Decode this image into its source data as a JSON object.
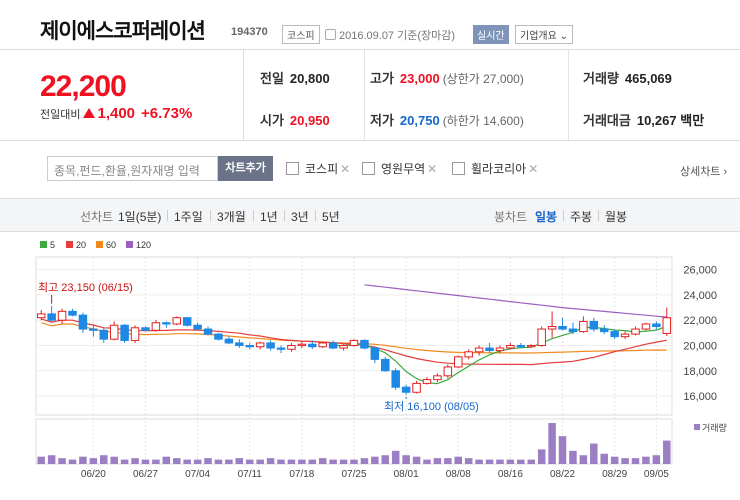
{
  "header": {
    "name": "제이에스코퍼레이션",
    "code": "194370",
    "market": "코스피",
    "date": "2016.09.07 기준(장마감)",
    "realtime": "실시간",
    "company_info": "기업개요"
  },
  "price": {
    "current": "22,200",
    "change_label": "전일대비",
    "change": "1,400",
    "change_pct": "+6.73%"
  },
  "stats": {
    "prev_label": "전일",
    "prev": "20,800",
    "high_label": "고가",
    "high": "23,000",
    "upper_limit": "(상한가 27,000)",
    "volume_label": "거래량",
    "volume": "465,069",
    "open_label": "시가",
    "open": "20,950",
    "low_label": "저가",
    "low": "20,750",
    "lower_limit": "(하한가 14,600)",
    "amount_label": "거래대금",
    "amount": "10,267",
    "amount_unit": "백만"
  },
  "compare": {
    "placeholder": "종목,펀드,환율,원자재명 입력",
    "add_button": "차트추가",
    "items": [
      "코스피",
      "영원무역",
      "휠라코리아"
    ],
    "detail": "상세차트"
  },
  "periods": {
    "line_label": "선차트",
    "line_options": [
      "1일(5분)",
      "1주일",
      "3개월",
      "1년",
      "3년",
      "5년"
    ],
    "candle_label": "봉차트",
    "candle_options": [
      "일봉",
      "주봉",
      "월봉"
    ],
    "active_candle": "일봉"
  },
  "colors": {
    "up": "#e12222",
    "down": "#1e88e5",
    "ma5": "#3daa3d",
    "ma20": "#e63c3c",
    "ma60": "#f08a1e",
    "ma120": "#9b5fc0",
    "volume": "#9b7ec4"
  },
  "legend": [
    "5",
    "20",
    "60",
    "120"
  ],
  "chart_data": {
    "type": "candlestick",
    "y_ticks": [
      "26,000",
      "24,000",
      "22,000",
      "20,000",
      "18,000",
      "16,000"
    ],
    "ylim": [
      14500,
      27000
    ],
    "x_labels": [
      "06/20",
      "06/27",
      "07/04",
      "07/11",
      "07/18",
      "07/25",
      "08/01",
      "08/08",
      "08/16",
      "08/22",
      "08/29",
      "09/05"
    ],
    "high_annotation": "최고 23,150 (06/15)",
    "low_annotation": "최저 16,100 (08/05)",
    "volume_label": "거래량",
    "candles": [
      [
        22200,
        22800,
        22000,
        22500
      ],
      [
        22500,
        23150,
        21800,
        22000
      ],
      [
        22000,
        22900,
        21700,
        22700
      ],
      [
        22700,
        22900,
        22300,
        22400
      ],
      [
        22400,
        22600,
        21000,
        21300
      ],
      [
        21300,
        21600,
        20700,
        21200
      ],
      [
        21200,
        21400,
        20200,
        20500
      ],
      [
        20500,
        21900,
        20400,
        21600
      ],
      [
        21600,
        21700,
        20200,
        20400
      ],
      [
        20400,
        21600,
        20200,
        21400
      ],
      [
        21400,
        21500,
        21100,
        21200
      ],
      [
        21200,
        22000,
        21100,
        21800
      ],
      [
        21800,
        21900,
        21400,
        21700
      ],
      [
        21700,
        22300,
        21600,
        22200
      ],
      [
        22200,
        22200,
        21500,
        21600
      ],
      [
        21600,
        21800,
        21200,
        21300
      ],
      [
        21300,
        21500,
        20800,
        20900
      ],
      [
        20900,
        21000,
        20400,
        20500
      ],
      [
        20500,
        20700,
        20100,
        20200
      ],
      [
        20200,
        20500,
        19800,
        20000
      ],
      [
        20000,
        20200,
        19700,
        19900
      ],
      [
        19900,
        20300,
        19700,
        20200
      ],
      [
        20200,
        20400,
        19600,
        19800
      ],
      [
        19800,
        20000,
        19400,
        19700
      ],
      [
        19700,
        20200,
        19500,
        20000
      ],
      [
        20000,
        20300,
        19800,
        20100
      ],
      [
        20100,
        20400,
        19700,
        19900
      ],
      [
        19900,
        20300,
        19800,
        20200
      ],
      [
        20200,
        20400,
        19700,
        19800
      ],
      [
        19800,
        20100,
        19600,
        20000
      ],
      [
        20000,
        20500,
        19900,
        20400
      ],
      [
        20400,
        20500,
        19700,
        19800
      ],
      [
        19800,
        19900,
        18600,
        18900
      ],
      [
        18900,
        19100,
        17900,
        18000
      ],
      [
        18000,
        18200,
        16500,
        16700
      ],
      [
        16700,
        16900,
        16100,
        16300
      ],
      [
        16300,
        17200,
        16200,
        17000
      ],
      [
        17000,
        17500,
        16900,
        17300
      ],
      [
        17300,
        17800,
        17100,
        17600
      ],
      [
        17600,
        18500,
        17400,
        18300
      ],
      [
        18300,
        19200,
        18200,
        19100
      ],
      [
        19100,
        19700,
        18900,
        19500
      ],
      [
        19500,
        20000,
        19200,
        19800
      ],
      [
        19800,
        20200,
        19400,
        19600
      ],
      [
        19600,
        20000,
        19400,
        19800
      ],
      [
        19800,
        20200,
        19700,
        20000
      ],
      [
        20000,
        20200,
        19800,
        19900
      ],
      [
        19900,
        20100,
        19800,
        20000
      ],
      [
        20000,
        21500,
        19900,
        21300
      ],
      [
        21300,
        22700,
        20600,
        21500
      ],
      [
        21500,
        22200,
        21200,
        21300
      ],
      [
        21300,
        21800,
        20900,
        21100
      ],
      [
        21100,
        22300,
        21000,
        21900
      ],
      [
        21900,
        22200,
        21100,
        21300
      ],
      [
        21300,
        21600,
        20900,
        21100
      ],
      [
        21100,
        21300,
        20500,
        20700
      ],
      [
        20700,
        21100,
        20500,
        20900
      ],
      [
        20900,
        21500,
        20800,
        21300
      ],
      [
        21300,
        21800,
        21200,
        21700
      ],
      [
        21700,
        21900,
        21300,
        21500
      ],
      [
        20950,
        23000,
        20750,
        22200
      ]
    ],
    "volumes": [
      5,
      6,
      4,
      3,
      5,
      4,
      6,
      5,
      3,
      4,
      3,
      3,
      5,
      4,
      3,
      3,
      4,
      3,
      3,
      4,
      3,
      3,
      4,
      3,
      3,
      3,
      3,
      4,
      3,
      3,
      3,
      4,
      5,
      6,
      9,
      6,
      5,
      3,
      4,
      4,
      5,
      4,
      3,
      3,
      3,
      3,
      3,
      3,
      10,
      28,
      19,
      9,
      6,
      14,
      7,
      5,
      4,
      4,
      5,
      6,
      16
    ]
  }
}
